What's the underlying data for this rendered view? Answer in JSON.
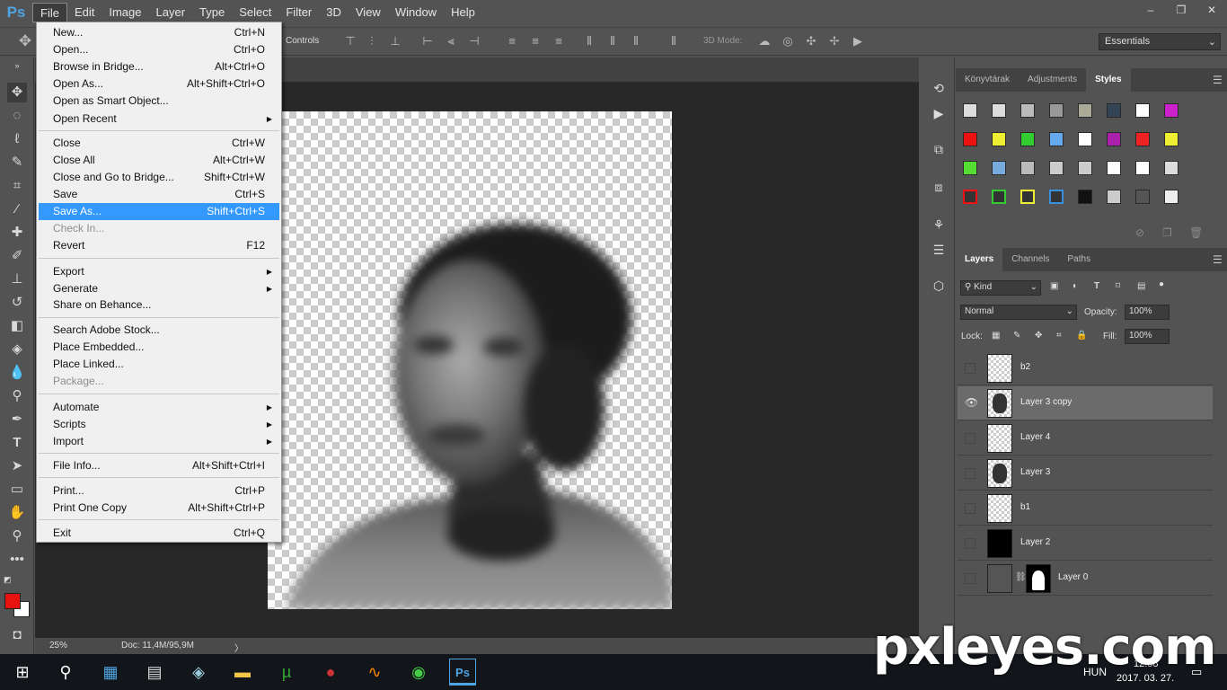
{
  "app": {
    "logo": "Ps"
  },
  "menubar": [
    "File",
    "Edit",
    "Image",
    "Layer",
    "Type",
    "Select",
    "Filter",
    "3D",
    "View",
    "Window",
    "Help"
  ],
  "window_controls": [
    "–",
    "❐",
    "✕"
  ],
  "options_bar": {
    "controls_label": "Controls",
    "mode_3d_label": "3D Mode:",
    "workspace": "Essentials"
  },
  "file_menu": [
    {
      "label": "New...",
      "shortcut": "Ctrl+N"
    },
    {
      "label": "Open...",
      "shortcut": "Ctrl+O"
    },
    {
      "label": "Browse in Bridge...",
      "shortcut": "Alt+Ctrl+O"
    },
    {
      "label": "Open As...",
      "shortcut": "Alt+Shift+Ctrl+O"
    },
    {
      "label": "Open as Smart Object...",
      "shortcut": ""
    },
    {
      "label": "Open Recent",
      "shortcut": ""
    },
    {
      "label": "Close",
      "shortcut": "Ctrl+W"
    },
    {
      "label": "Close All",
      "shortcut": "Alt+Ctrl+W"
    },
    {
      "label": "Close and Go to Bridge...",
      "shortcut": "Shift+Ctrl+W"
    },
    {
      "label": "Save",
      "shortcut": "Ctrl+S"
    },
    {
      "label": "Save As...",
      "shortcut": "Shift+Ctrl+S"
    },
    {
      "label": "Check In...",
      "shortcut": ""
    },
    {
      "label": "Revert",
      "shortcut": "F12"
    },
    {
      "label": "Export",
      "shortcut": ""
    },
    {
      "label": "Generate",
      "shortcut": ""
    },
    {
      "label": "Share on Behance...",
      "shortcut": ""
    },
    {
      "label": "Search Adobe Stock...",
      "shortcut": ""
    },
    {
      "label": "Place Embedded...",
      "shortcut": ""
    },
    {
      "label": "Place Linked...",
      "shortcut": ""
    },
    {
      "label": "Package...",
      "shortcut": ""
    },
    {
      "label": "Automate",
      "shortcut": ""
    },
    {
      "label": "Scripts",
      "shortcut": ""
    },
    {
      "label": "Import",
      "shortcut": ""
    },
    {
      "label": "File Info...",
      "shortcut": "Alt+Shift+Ctrl+I"
    },
    {
      "label": "Print...",
      "shortcut": "Ctrl+P"
    },
    {
      "label": "Print One Copy",
      "shortcut": "Alt+Shift+Ctrl+P"
    },
    {
      "label": "Exit",
      "shortcut": "Ctrl+Q"
    }
  ],
  "status": {
    "zoom": "25%",
    "doc": "Doc: 11,4M/95,9M",
    "arrow": "〉"
  },
  "styles_panel": {
    "tabs": [
      "Könyvtárak",
      "Adjustments",
      "Styles"
    ]
  },
  "layers_panel": {
    "tabs": [
      "Layers",
      "Channels",
      "Paths"
    ],
    "filter_kind": "Kind",
    "blend_mode": "Normal",
    "opacity_label": "Opacity:",
    "opacity": "100%",
    "lock_label": "Lock:",
    "fill_label": "Fill:",
    "fill": "100%",
    "layers": [
      "b2",
      "Layer 3 copy",
      "Layer 4",
      "Layer 3",
      "b1",
      "Layer 2",
      "Layer 0"
    ]
  },
  "taskbar": {
    "language": "HUN",
    "time": "12:58",
    "date": "2017. 03. 27."
  },
  "watermark": "pxleyes.com",
  "colors": {
    "foreground": "#e8130f",
    "background": "#ffffff",
    "menu_highlight": "#3399ff",
    "ps_blue": "#4fa5e0"
  }
}
